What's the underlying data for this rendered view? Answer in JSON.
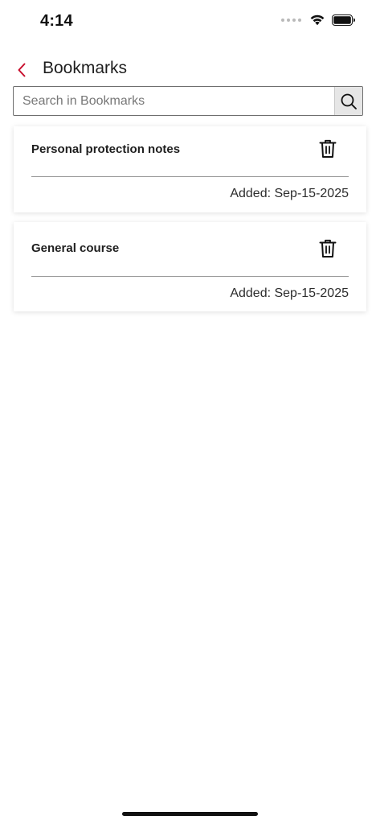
{
  "status_bar": {
    "time": "4:14"
  },
  "header": {
    "title": "Bookmarks"
  },
  "search": {
    "placeholder": "Search in Bookmarks",
    "value": ""
  },
  "bookmarks": [
    {
      "title": "Personal protection notes",
      "added": "Added: Sep-15-2025"
    },
    {
      "title": "General course",
      "added": "Added: Sep-15-2025"
    }
  ],
  "colors": {
    "accent": "#c8102e",
    "text": "#222222",
    "search_button_bg": "#e6e6e6"
  },
  "icons": {
    "back": "chevron-left-icon",
    "search": "search-icon",
    "delete": "trash-icon",
    "wifi": "wifi-icon",
    "battery": "battery-icon"
  }
}
